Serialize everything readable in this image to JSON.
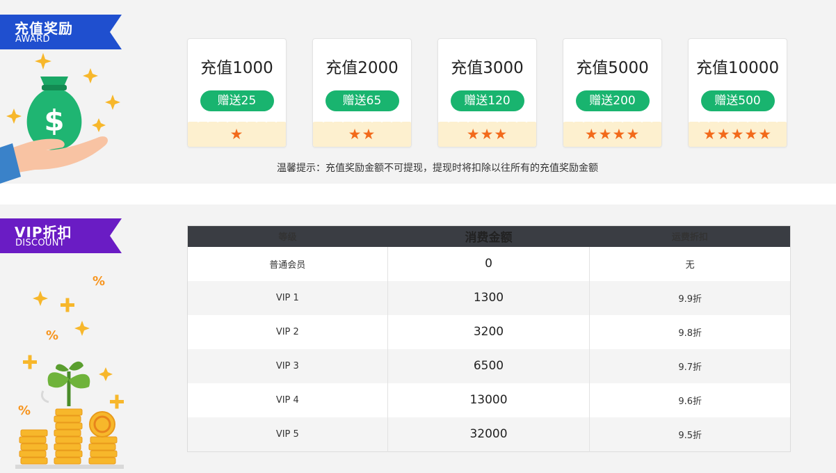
{
  "award": {
    "title": "充值奖励",
    "subtitle": "AWARD",
    "ribbon_color": "#1f4fcf",
    "cards": [
      {
        "amount": "充值1000",
        "bonus": "赠送25",
        "stars": "★",
        "star_count": 1
      },
      {
        "amount": "充值2000",
        "bonus": "赠送65",
        "stars": "★★",
        "star_count": 2
      },
      {
        "amount": "充值3000",
        "bonus": "赠送120",
        "stars": "★★★",
        "star_count": 3
      },
      {
        "amount": "充值5000",
        "bonus": "赠送200",
        "stars": "★★★★",
        "star_count": 4
      },
      {
        "amount": "充值10000",
        "bonus": "赠送500",
        "stars": "★★★★★",
        "star_count": 5
      }
    ],
    "tip": "温馨提示：充值奖励金额不可提现，提现时将扣除以往所有的充值奖励金额",
    "bonus_color": "#19b46f",
    "star_color": "#f26a1b",
    "illustration_icon": "money-bag-in-hand-icon"
  },
  "vip": {
    "title": "VIP折扣",
    "subtitle": "DISCOUNT",
    "ribbon_color": "#6a1cc4",
    "headers": [
      "等级",
      "消费金额",
      "运费折扣"
    ],
    "rows": [
      {
        "level": "普通会员",
        "spend": "0",
        "discount": "无"
      },
      {
        "level": "VIP 1",
        "spend": "1300",
        "discount": "9.9折"
      },
      {
        "level": "VIP 2",
        "spend": "3200",
        "discount": "9.8折"
      },
      {
        "level": "VIP 3",
        "spend": "6500",
        "discount": "9.7折"
      },
      {
        "level": "VIP 4",
        "spend": "13000",
        "discount": "9.6折"
      },
      {
        "level": "VIP 5",
        "spend": "32000",
        "discount": "9.5折"
      }
    ],
    "illustration_icon": "plant-coins-icon"
  }
}
